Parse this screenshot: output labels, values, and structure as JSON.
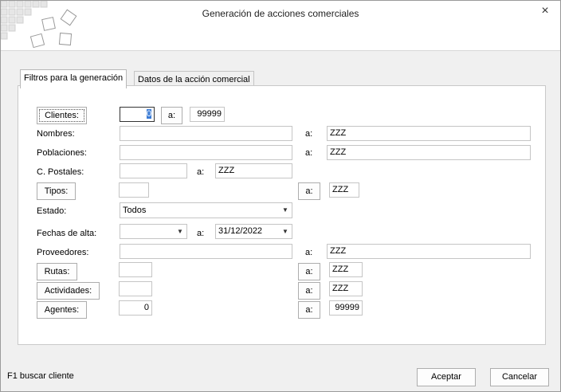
{
  "window": {
    "title": "Generación de acciones comerciales",
    "close_icon": "×"
  },
  "tabs": [
    {
      "label": "Filtros para la generación",
      "active": true
    },
    {
      "label": "Datos de la acción comercial",
      "active": false
    }
  ],
  "form": {
    "clientes": {
      "button": "Clientes:",
      "from": "0",
      "to_button": "a:",
      "to": "99999"
    },
    "nombres": {
      "label": "Nombres:",
      "from": "",
      "to_label": "a:",
      "to": "ZZZ"
    },
    "poblaciones": {
      "label": "Poblaciones:",
      "from": "",
      "to_label": "a:",
      "to": "ZZZ"
    },
    "postales": {
      "label": "C. Postales:",
      "from": "",
      "to_label": "a:",
      "to": "ZZZ"
    },
    "tipos": {
      "button": "Tipos:",
      "from": "",
      "to_button": "a:",
      "to": "ZZZ"
    },
    "estado": {
      "label": "Estado:",
      "value": "Todos"
    },
    "fechas": {
      "label": "Fechas de alta:",
      "from": "",
      "to_label": "a:",
      "to": "31/12/2022"
    },
    "proveedores": {
      "label": "Proveedores:",
      "from": "",
      "to_label": "a:",
      "to": "ZZZ"
    },
    "rutas": {
      "button": "Rutas:",
      "from": "",
      "to_button": "a:",
      "to": "ZZZ"
    },
    "actividades": {
      "button": "Actividades:",
      "from": "",
      "to_button": "a:",
      "to": "ZZZ"
    },
    "agentes": {
      "button": "Agentes:",
      "from": "0",
      "to_button": "a:",
      "to": "99999"
    }
  },
  "footer": {
    "hint": "F1 buscar cliente",
    "accept": "Aceptar",
    "cancel": "Cancelar"
  },
  "icons": {
    "dropdown": "chevron-down-icon",
    "close": "close-icon",
    "logo": "squares-logo"
  },
  "colors": {
    "body_bg": "#f0f0f0",
    "selection": "#3a7bd5"
  }
}
